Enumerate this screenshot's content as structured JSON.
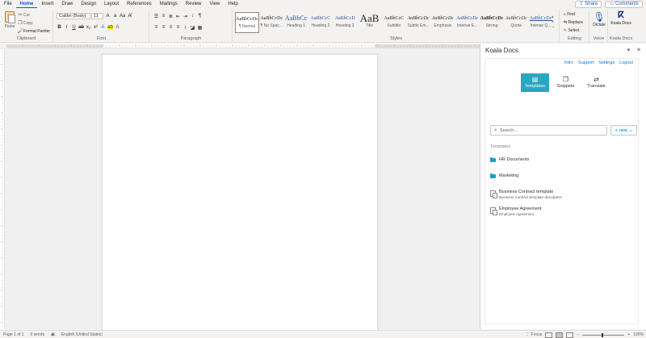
{
  "menu": {
    "tabs": [
      "File",
      "Home",
      "Insert",
      "Draw",
      "Design",
      "Layout",
      "References",
      "Mailings",
      "Review",
      "View",
      "Help"
    ],
    "active": "Home",
    "share_label": "Share",
    "comments_label": "Comments"
  },
  "ribbon": {
    "clipboard": {
      "paste": "Paste",
      "cut": "Cut",
      "copy": "Copy",
      "format_painter": "Format Painter",
      "label": "Clipboard"
    },
    "font": {
      "name": "Calibri (Body)",
      "size": "11",
      "label": "Font"
    },
    "paragraph": {
      "label": "Paragraph"
    },
    "styles": {
      "label": "Styles",
      "items": [
        {
          "sample": "AaBbCcDc",
          "name": "¶ Normal"
        },
        {
          "sample": "AaBbCcDc",
          "name": "¶ No Spac..."
        },
        {
          "sample": "AaBbCc",
          "name": "Heading 1"
        },
        {
          "sample": "AaBbCcC",
          "name": "Heading 2"
        },
        {
          "sample": "AaBbCcD",
          "name": "Heading 3"
        },
        {
          "sample": "AaB",
          "name": "Title"
        },
        {
          "sample": "AaBbCcC",
          "name": "Subtitle"
        },
        {
          "sample": "AaBbCcDc",
          "name": "Subtle Em..."
        },
        {
          "sample": "AaBbCcDc",
          "name": "Emphasis"
        },
        {
          "sample": "AaBbCcDc",
          "name": "Intense E..."
        },
        {
          "sample": "AaBbCcDc",
          "name": "Strong"
        },
        {
          "sample": "AaBbCcDc",
          "name": "Quote"
        },
        {
          "sample": "AaBbCcDc",
          "name": "Intense Q..."
        }
      ]
    },
    "editing": {
      "find": "Find",
      "replace": "Replace",
      "select": "Select",
      "label": "Editing"
    },
    "voice": {
      "dictate": "Dictate",
      "label": "Voice"
    },
    "addin": {
      "name": "Koala Docs",
      "label": "Koala Docs"
    }
  },
  "pane": {
    "title": "Koala Docs",
    "links": [
      "Intro",
      "Support",
      "Settings",
      "Logout"
    ],
    "tabs": [
      {
        "label": "Templates",
        "icon": "▤"
      },
      {
        "label": "Snippets",
        "icon": "❐"
      },
      {
        "label": "Translate",
        "icon": "⇄"
      }
    ],
    "search_placeholder": "Search...",
    "new_label": "new",
    "section_label": "Templates",
    "items": [
      {
        "type": "folder",
        "title": "HR Documents",
        "desc": ""
      },
      {
        "type": "folder",
        "title": "Marketing",
        "desc": ""
      },
      {
        "type": "doc",
        "title": "Business Contract template",
        "desc": "Business Contract template description"
      },
      {
        "type": "doc",
        "title": "Employee Agreement",
        "desc": "Employee Agreement"
      }
    ]
  },
  "status": {
    "page": "Page 1 of 1",
    "words": "0 words",
    "language": "English (United States)",
    "focus": "Focus",
    "zoom": "100%"
  },
  "colors": {
    "accent": "#185abd",
    "pane_tab_selected": "#2aa6bf",
    "folder": "#1aa0c9",
    "link": "#0078d4"
  }
}
